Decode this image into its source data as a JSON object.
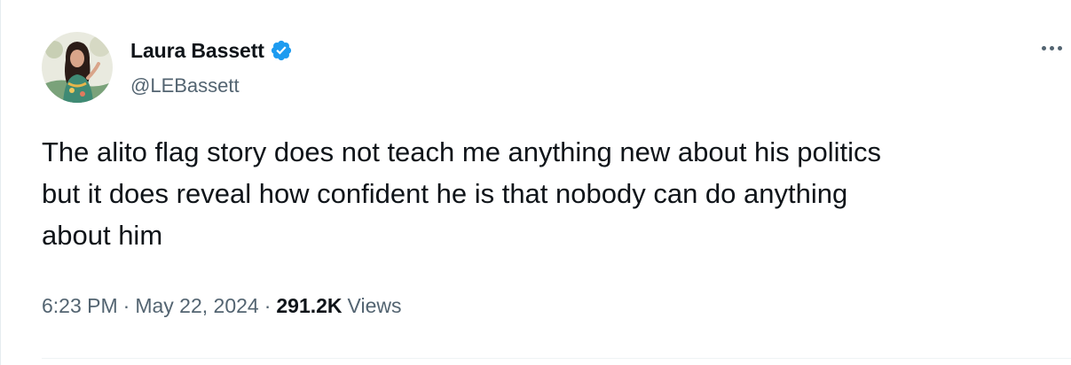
{
  "author": {
    "display_name": "Laura Bassett",
    "handle": "@LEBassett",
    "verified": true,
    "verified_color": "#1d9bf0"
  },
  "tweet": {
    "text": "The alito flag story does not teach me anything new about his politics\nbut it does reveal how confident he is that nobody can do anything\nabout him",
    "time": "6:23 PM",
    "date": "May 22, 2024",
    "separator": "·",
    "views_count": "291.2K",
    "views_label": "Views"
  },
  "icons": {
    "more": "more-horizontal-icon",
    "verified": "verified-badge-icon"
  },
  "colors": {
    "text_primary": "#0f1419",
    "text_secondary": "#536471",
    "accent": "#1d9bf0"
  }
}
